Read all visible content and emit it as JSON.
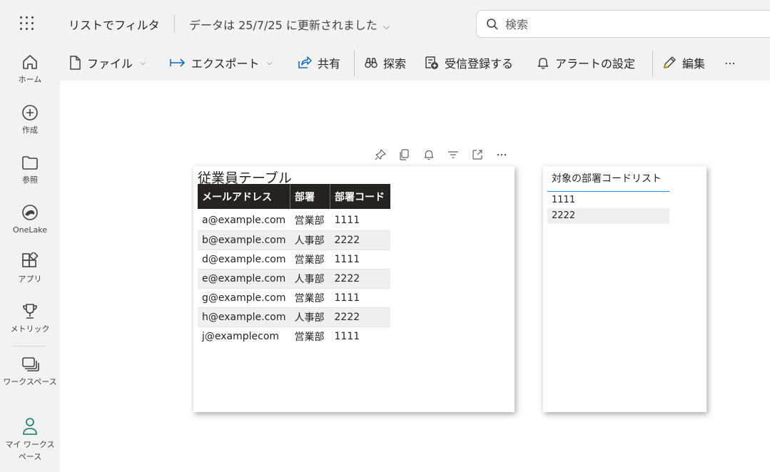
{
  "nav": {
    "items": [
      {
        "label": "ホーム",
        "icon": "home-icon"
      },
      {
        "label": "作成",
        "icon": "create-icon"
      },
      {
        "label": "参照",
        "icon": "folder-icon"
      },
      {
        "label": "OneLake",
        "icon": "onelake-icon"
      },
      {
        "label": "アプリ",
        "icon": "apps-icon"
      },
      {
        "label": "メトリック",
        "icon": "trophy-icon"
      },
      {
        "label": "ワークスペース",
        "icon": "workspaces-icon"
      },
      {
        "label": "マイ ワークスペース",
        "icon": "person-icon"
      }
    ]
  },
  "header": {
    "report_title": "リストでフィルタ",
    "refresh_text": "データは 25/7/25 に更新されました",
    "search_placeholder": "検索"
  },
  "toolbar": {
    "file": "ファイル",
    "export": "エクスポート",
    "share": "共有",
    "explore": "探索",
    "subscribe": "受信登録する",
    "alert": "アラートの設定",
    "edit": "編集",
    "more": "⋯"
  },
  "visual_actions": [
    "pin-icon",
    "copy-icon",
    "bell-icon",
    "filter-icon",
    "focus-mode-icon",
    "more-options-icon"
  ],
  "employee_table": {
    "title": "従業員テーブル",
    "columns": [
      "メールアドレス",
      "部署",
      "部署コード"
    ],
    "rows": [
      [
        "a@example.com",
        "営業部",
        "1111"
      ],
      [
        "b@example.com",
        "人事部",
        "2222"
      ],
      [
        "d@example.com",
        "営業部",
        "1111"
      ],
      [
        "e@example.com",
        "人事部",
        "2222"
      ],
      [
        "g@example.com",
        "営業部",
        "1111"
      ],
      [
        "h@example.com",
        "人事部",
        "2222"
      ],
      [
        "j@examplecom",
        "営業部",
        "1111"
      ]
    ]
  },
  "slicer": {
    "title": "対象の部署コードリスト",
    "items": [
      "1111",
      "2222"
    ]
  },
  "colors": {
    "rail_bg": "#f2f2f2",
    "table_header_bg": "#252423",
    "slicer_accent": "#118dff"
  }
}
